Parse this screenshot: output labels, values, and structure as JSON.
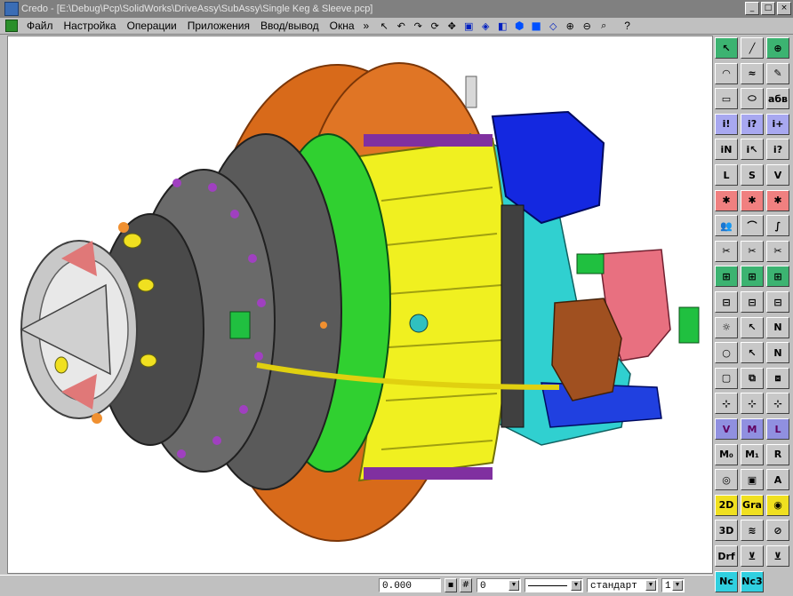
{
  "window": {
    "title": "Credo - [E:\\Debug\\Pcp\\SolidWorks\\DriveAssy\\SubAssy\\Single Keg & Sleeve.pcp]",
    "min_label": "_",
    "max_label": "□",
    "close_label": "×"
  },
  "menu": {
    "items": [
      "Файл",
      "Настройка",
      "Операции",
      "Приложения",
      "Ввод/вывод",
      "Окна"
    ],
    "overflow": "»",
    "help": "?"
  },
  "toolbar": {
    "icons": [
      "pointer-icon",
      "undo-icon",
      "redo-icon",
      "rotate-icon",
      "pan-icon",
      "view-cube-icon",
      "iso-view-icon",
      "front-view-icon",
      "top-view-icon",
      "shaded-icon",
      "wireframe-icon",
      "zoom-in-icon",
      "zoom-out-icon",
      "zoom-window-icon"
    ]
  },
  "panel": {
    "buttons": [
      {
        "id": "select",
        "label": "↖",
        "color": "green"
      },
      {
        "id": "line",
        "label": "╱",
        "color": "grey"
      },
      {
        "id": "circle-target",
        "label": "⊕",
        "color": "green"
      },
      {
        "id": "arc",
        "label": "◠",
        "color": "grey"
      },
      {
        "id": "spline",
        "label": "≈",
        "color": "grey"
      },
      {
        "id": "pen",
        "label": "✎",
        "color": "grey"
      },
      {
        "id": "rect",
        "label": "▭",
        "color": "grey"
      },
      {
        "id": "ellipse",
        "label": "⬭",
        "color": "grey"
      },
      {
        "id": "text",
        "label": "абв",
        "color": "grey"
      },
      {
        "id": "info1",
        "label": "i!",
        "color": "blue"
      },
      {
        "id": "info2",
        "label": "i?",
        "color": "blue"
      },
      {
        "id": "info3",
        "label": "i+",
        "color": "blue"
      },
      {
        "id": "info-n",
        "label": "iN",
        "color": "grey"
      },
      {
        "id": "info-k",
        "label": "i↖",
        "color": "grey"
      },
      {
        "id": "info-q",
        "label": "i?",
        "color": "grey"
      },
      {
        "id": "mass-l",
        "label": "L",
        "color": "grey"
      },
      {
        "id": "mass-s",
        "label": "S",
        "color": "grey"
      },
      {
        "id": "mass-v",
        "label": "V",
        "color": "grey"
      },
      {
        "id": "tree1",
        "label": "✱",
        "color": "pink"
      },
      {
        "id": "tree2",
        "label": "✱",
        "color": "pink"
      },
      {
        "id": "tree3",
        "label": "✱",
        "color": "pink"
      },
      {
        "id": "people",
        "label": "👥",
        "color": "grey"
      },
      {
        "id": "curve1",
        "label": "⌒",
        "color": "grey"
      },
      {
        "id": "curve2",
        "label": "∫",
        "color": "grey"
      },
      {
        "id": "cut1",
        "label": "✂",
        "color": "grey"
      },
      {
        "id": "cut2",
        "label": "✂",
        "color": "grey"
      },
      {
        "id": "cut3",
        "label": "✂",
        "color": "grey"
      },
      {
        "id": "gen1",
        "label": "⊞",
        "color": "green"
      },
      {
        "id": "gen2",
        "label": "⊞",
        "color": "green"
      },
      {
        "id": "gen3",
        "label": "⊞",
        "color": "green"
      },
      {
        "id": "op1",
        "label": "⊟",
        "color": "grey"
      },
      {
        "id": "op2",
        "label": "⊟",
        "color": "grey"
      },
      {
        "id": "op3",
        "label": "⊟",
        "color": "grey"
      },
      {
        "id": "light1",
        "label": "☼",
        "color": "grey"
      },
      {
        "id": "arrow1",
        "label": "↖",
        "color": "grey"
      },
      {
        "id": "n1",
        "label": "N",
        "color": "grey"
      },
      {
        "id": "bulb",
        "label": "○",
        "color": "grey"
      },
      {
        "id": "arrow2",
        "label": "↖",
        "color": "grey"
      },
      {
        "id": "n2",
        "label": "N",
        "color": "grey"
      },
      {
        "id": "view1",
        "label": "▢",
        "color": "grey"
      },
      {
        "id": "view2",
        "label": "⧉",
        "color": "grey"
      },
      {
        "id": "view3",
        "label": "⧈",
        "color": "grey"
      },
      {
        "id": "axis1",
        "label": "⊹",
        "color": "grey"
      },
      {
        "id": "axis2",
        "label": "⊹",
        "color": "grey"
      },
      {
        "id": "axis3",
        "label": "⊹",
        "color": "grey"
      },
      {
        "id": "v",
        "label": "V",
        "color": "purple"
      },
      {
        "id": "m",
        "label": "M",
        "color": "purple"
      },
      {
        "id": "l",
        "label": "L",
        "color": "purple"
      },
      {
        "id": "m0",
        "label": "M₀",
        "color": "grey"
      },
      {
        "id": "m1",
        "label": "M₁",
        "color": "grey"
      },
      {
        "id": "r",
        "label": "R",
        "color": "grey"
      },
      {
        "id": "sphere",
        "label": "◎",
        "color": "grey"
      },
      {
        "id": "box",
        "label": "▣",
        "color": "grey"
      },
      {
        "id": "a",
        "label": "A",
        "color": "grey"
      },
      {
        "id": "2d",
        "label": "2D",
        "color": "yellow"
      },
      {
        "id": "gra",
        "label": "Gra",
        "color": "yellow"
      },
      {
        "id": "lips",
        "label": "◉",
        "color": "yellow"
      },
      {
        "id": "3d",
        "label": "3D",
        "color": "grey"
      },
      {
        "id": "layers",
        "label": "≋",
        "color": "grey"
      },
      {
        "id": "circle-hatch",
        "label": "⊘",
        "color": "grey"
      },
      {
        "id": "drf",
        "label": "Drf",
        "color": "grey"
      },
      {
        "id": "tool2",
        "label": "⊻",
        "color": "grey"
      },
      {
        "id": "tool3",
        "label": "⊻",
        "color": "grey"
      },
      {
        "id": "nc",
        "label": "Nc",
        "color": "cyan"
      },
      {
        "id": "nc3",
        "label": "Nc3",
        "color": "cyan"
      }
    ]
  },
  "status": {
    "coord": "0.000",
    "layer": "0",
    "style": "стандарт",
    "scale": "1"
  }
}
